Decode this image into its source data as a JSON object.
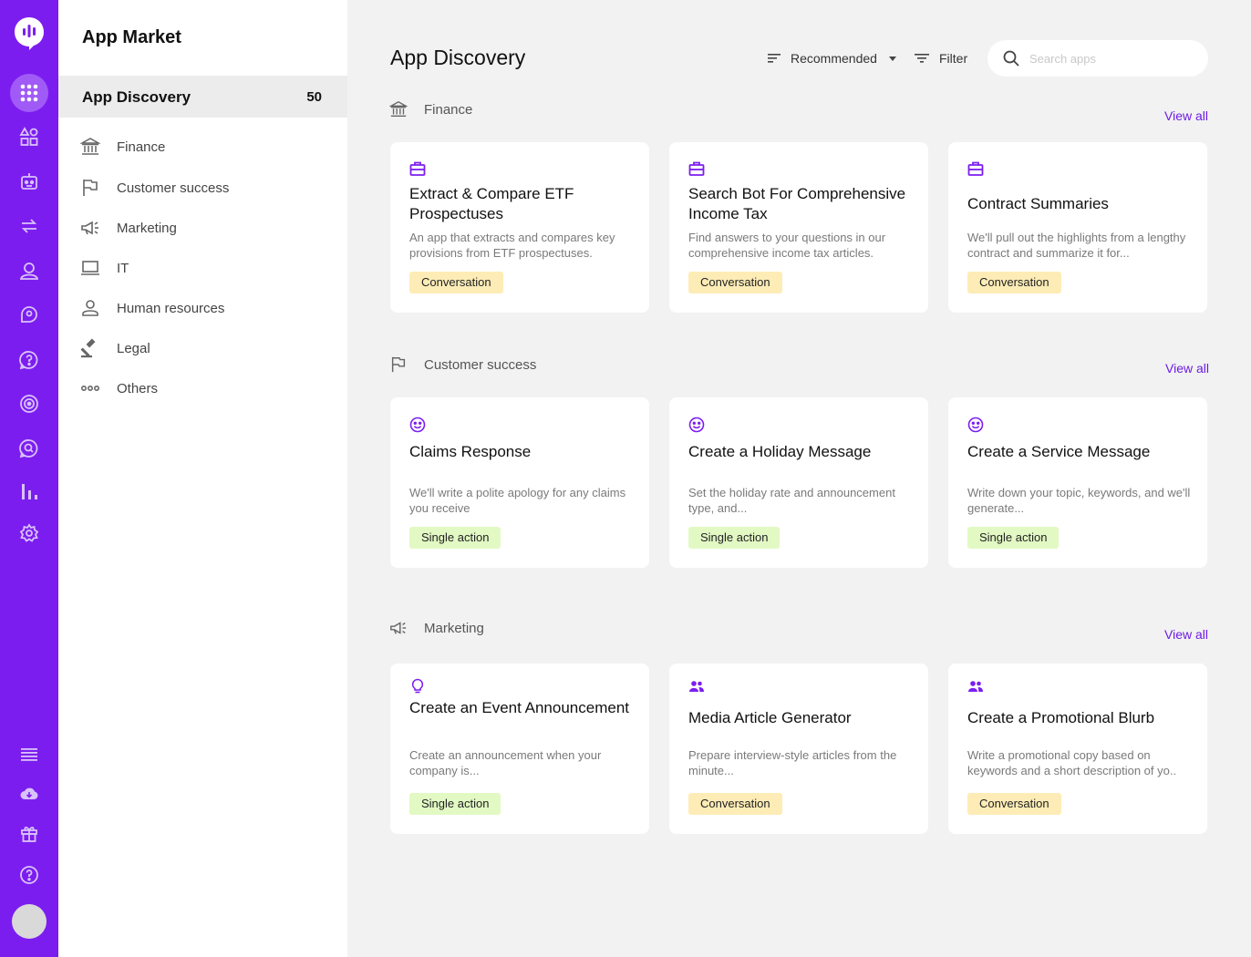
{
  "app": {
    "title": "App Market",
    "colors": {
      "accent": "#7c1df0",
      "link": "#6c1be3",
      "conversation_tag": "#fdecb6",
      "single_action_tag": "#e2f9c4"
    }
  },
  "rail": {
    "icons": [
      "logo-icon",
      "apps-grid-icon",
      "shapes-icon",
      "robot-icon",
      "transfer-icon",
      "user-icon",
      "chat-user-icon",
      "help-chat-icon",
      "radar-icon",
      "search-chat-icon",
      "bar-chart-icon",
      "settings-icon",
      "list-icon",
      "cloud-download-icon",
      "gift-icon",
      "help-icon",
      "avatar"
    ]
  },
  "sidebar": {
    "discovery": {
      "label": "App Discovery",
      "count": "50"
    },
    "categories": [
      {
        "label": "Finance",
        "icon": "bank-icon"
      },
      {
        "label": "Customer success",
        "icon": "flag-icon"
      },
      {
        "label": "Marketing",
        "icon": "megaphone-icon"
      },
      {
        "label": "IT",
        "icon": "laptop-icon"
      },
      {
        "label": "Human resources",
        "icon": "person-icon"
      },
      {
        "label": "Legal",
        "icon": "gavel-icon"
      },
      {
        "label": "Others",
        "icon": "dots-icon"
      }
    ]
  },
  "main": {
    "title": "App Discovery",
    "sort_label": "Recommended",
    "filter_label": "Filter",
    "search": {
      "placeholder": "Search apps",
      "value": ""
    },
    "sections": [
      {
        "name": "Finance",
        "view_all": "View all",
        "cards": [
          {
            "title": "Extract & Compare ETF Prospectuses",
            "desc": "An app that extracts and compares key provisions from ETF prospectuses.",
            "tag": "Conversation",
            "icon": "briefcase-icon"
          },
          {
            "title": "Search Bot For Comprehensive Income Tax",
            "desc": "Find answers to your questions in our comprehensive income tax articles.",
            "tag": "Conversation",
            "icon": "briefcase-icon"
          },
          {
            "title": "Contract Summaries",
            "desc": "We'll pull out the highlights from a lengthy contract and summarize it for...",
            "tag": "Conversation",
            "icon": "briefcase-icon"
          }
        ]
      },
      {
        "name": "Customer success",
        "view_all": "View all",
        "cards": [
          {
            "title": "Claims Response",
            "desc": "We'll write a polite apology for any claims you receive",
            "tag": "Single action",
            "icon": "smile-icon"
          },
          {
            "title": "Create a Holiday Message",
            "desc": "Set the holiday rate and announcement type, and...",
            "tag": "Single action",
            "icon": "smile-icon"
          },
          {
            "title": "Create a Service Message",
            "desc": "Write down your topic, keywords, and we'll generate...",
            "tag": "Single action",
            "icon": "smile-icon"
          }
        ]
      },
      {
        "name": "Marketing",
        "view_all": "View all",
        "cards": [
          {
            "title": "Create an Event Announcement",
            "desc": "Create an announcement when your company is...",
            "tag": "Single action",
            "icon": "lightbulb-icon"
          },
          {
            "title": "Media Article Generator",
            "desc": "Prepare interview-style articles from the minute...",
            "tag": "Conversation",
            "icon": "people-icon"
          },
          {
            "title": "Create a Promotional Blurb",
            "desc": "Write a promotional copy based on keywords and a short description of yo..",
            "tag": "Conversation",
            "icon": "people-icon"
          }
        ]
      }
    ]
  }
}
